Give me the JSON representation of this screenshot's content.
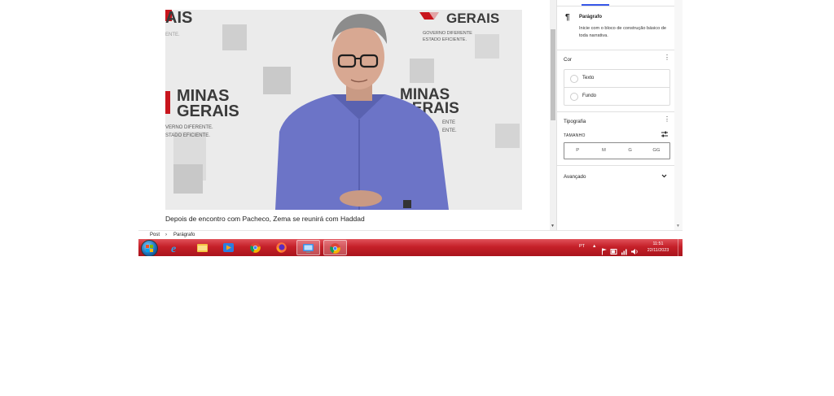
{
  "editor": {
    "image_alt": "Foto: homem de camisa azul em frente a painel Minas Gerais",
    "backdrop_text": {
      "top_left": "AIS",
      "top_right": "GERAIS",
      "top_left_sub": "ENTE.",
      "top_right_sub1": "GOVERNO DIFERENTE",
      "top_right_sub2": "ESTADO EFICIENTE.",
      "mid_left1": "MINAS",
      "mid_left2": "GERAIS",
      "mid_left_sub1": "VERNO DIFERENTE.",
      "mid_left_sub2": "STADO EFICIENTE.",
      "mid_right1": "MINAS",
      "mid_right2": "GERAIS",
      "mid_right_sub1": "ENTE",
      "mid_right_sub2": "ENTE."
    },
    "caption": "Depois de encontro com Pacheco, Zema se reunirá com Haddad"
  },
  "sidebar": {
    "block": {
      "title": "Parágrafo",
      "description": "Inicie com o bloco de construção básico de toda narrativa."
    },
    "color": {
      "title": "Cor",
      "text_label": "Texto",
      "background_label": "Fundo"
    },
    "typography": {
      "title": "Tipografia",
      "size_label": "TAMANHO",
      "sizes": [
        "P",
        "M",
        "G",
        "GG"
      ]
    },
    "advanced": {
      "title": "Avançado"
    }
  },
  "breadcrumb": {
    "root": "Post",
    "separator": "›",
    "current": "Parágrafo"
  },
  "taskbar": {
    "language": "PT",
    "time": "11:51",
    "date": "22/11/2023",
    "colors": {
      "bar": "#c52029",
      "accent": "#3858e9"
    },
    "apps": [
      "start-orb",
      "internet-explorer",
      "file-explorer",
      "media-player",
      "chrome",
      "firefox",
      "remote-desktop",
      "chrome-active"
    ]
  }
}
